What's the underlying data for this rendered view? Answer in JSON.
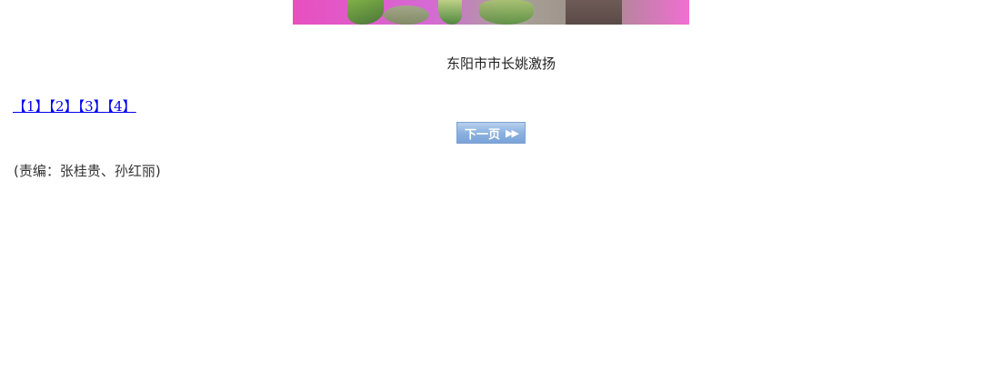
{
  "caption": "东阳市市长姚激扬",
  "pagination": {
    "pages": [
      "【1】",
      "【2】",
      "【3】",
      "【4】"
    ]
  },
  "next_button": {
    "label": "下一页",
    "icon": "double-chevron-right-icon"
  },
  "editor_note": "(责编：张桂贵、孙红丽)"
}
